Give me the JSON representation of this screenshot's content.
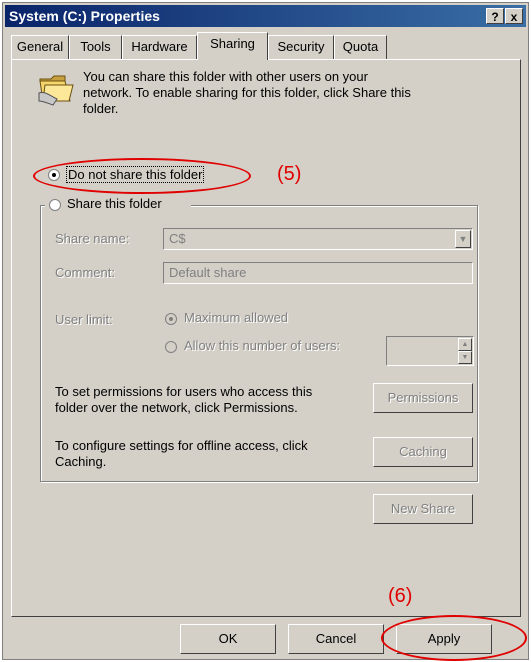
{
  "window": {
    "title": "System (C:) Properties",
    "help_btn": "?",
    "close_btn": "x"
  },
  "tabs": [
    "General",
    "Tools",
    "Hardware",
    "Sharing",
    "Security",
    "Quota"
  ],
  "active_tab": "Sharing",
  "sharing": {
    "info_line1": "You can share this folder with other users on your",
    "info_line2": "network.  To enable sharing for this folder, click Share this",
    "info_line3": "folder.",
    "radio_no_share": "Do not share this folder",
    "radio_share": "Share this folder",
    "share_name_label": "Share name:",
    "share_name_value": "C$",
    "comment_label": "Comment:",
    "comment_value": "Default share",
    "user_limit_label": "User limit:",
    "max_allowed": "Maximum allowed",
    "allow_number": "Allow this number of users:",
    "perm_text1": "To set permissions for users who access this",
    "perm_text2": "folder over the network, click Permissions.",
    "permissions_btn": "Permissions",
    "cache_text1": "To configure settings for offline access, click",
    "cache_text2": "Caching.",
    "caching_btn": "Caching",
    "new_share_btn": "New Share"
  },
  "footer": {
    "ok": "OK",
    "cancel": "Cancel",
    "apply": "Apply"
  },
  "annotations": {
    "label5": "(5)",
    "label6": "(6)"
  },
  "colors": {
    "annotation": "#e00000",
    "titlebar": "#0a246a",
    "face": "#d4d0c8"
  }
}
